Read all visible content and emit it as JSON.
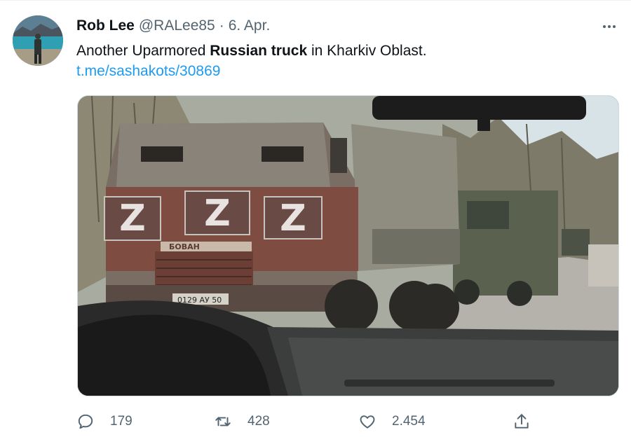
{
  "tweet": {
    "author_name": "Rob Lee",
    "author_handle": "@RALee85",
    "separator": "·",
    "date": "6. Apr.",
    "text_parts": {
      "before": "Another Uparmored ",
      "bold": "Russian truck",
      "after": " in Kharkiv Oblast."
    },
    "link": "t.me/sashakots/30869",
    "media": {
      "z_marking": "Z",
      "plate_text": "0129 АУ 50",
      "nameplate_text": "БОВАН"
    }
  },
  "actions": {
    "replies": "179",
    "retweets": "428",
    "likes": "2.454"
  },
  "icons": {
    "more": "more-icon",
    "reply": "reply-icon",
    "retweet": "retweet-icon",
    "like": "like-icon",
    "share": "share-icon"
  },
  "colors": {
    "link": "#1d9bf0",
    "secondary_text": "#536471",
    "primary_text": "#0f1419"
  }
}
